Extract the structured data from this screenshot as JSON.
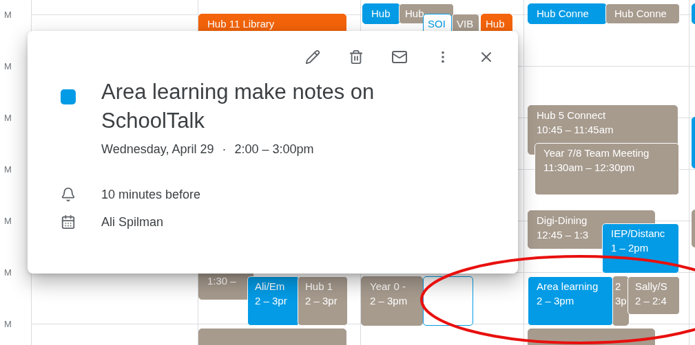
{
  "time_labels": [
    "M",
    "M",
    "M",
    "M",
    "M",
    "M",
    "M"
  ],
  "events": [
    {
      "kind": "filled",
      "color": "#f4640a",
      "title": "Hub 11 Library"
    },
    {
      "kind": "filled",
      "color": "#039be5",
      "title": "Hub"
    },
    {
      "kind": "filled",
      "color": "#a79b8e",
      "title": "Hub"
    },
    {
      "kind": "outlined",
      "color": "#039be5",
      "title": "SOI"
    },
    {
      "kind": "filled",
      "color": "#a79b8e",
      "title": "VIB"
    },
    {
      "kind": "filled",
      "color": "#f4640a",
      "title": "Hub"
    },
    {
      "kind": "filled",
      "color": "#039be5",
      "title": "Hub Conne"
    },
    {
      "kind": "filled",
      "color": "#a79b8e",
      "title": "Hub Conne"
    },
    {
      "kind": "filled",
      "color": "#039be5"
    },
    {
      "kind": "filled",
      "color": "#a79b8e",
      "title": "Hub 5 Connect",
      "time": "10:45 – 11:45am"
    },
    {
      "kind": "filled",
      "color": "#a79b8e",
      "title": "Year 7/8 Team Meeting",
      "time": "11:30am – 12:30pm"
    },
    {
      "kind": "filled",
      "color": "#039be5"
    },
    {
      "kind": "filled",
      "color": "#a79b8e",
      "title": "Digi-Dining",
      "time": "12:45 – 1:3"
    },
    {
      "kind": "filled",
      "color": "#a79b8e"
    },
    {
      "kind": "filled",
      "color": "#039be5",
      "title": "IEP/Distanc",
      "time": "1 – 2pm"
    },
    {
      "kind": "filled",
      "color": "#a79b8e",
      "time": "1:30 –"
    },
    {
      "kind": "filled",
      "color": "#039be5",
      "title": "Ali/Em",
      "time": "2 – 3pr"
    },
    {
      "kind": "filled",
      "color": "#a79b8e",
      "title": "Hub 1",
      "time": "2 – 3pr"
    },
    {
      "kind": "filled",
      "color": "#a79b8e",
      "title": "Year 0 -",
      "time": "2 – 3pm"
    },
    {
      "kind": "outlined",
      "color": "#039be5"
    },
    {
      "kind": "filled",
      "color": "#039be5",
      "title": "Area learning",
      "time": "2 – 3pm"
    },
    {
      "kind": "filled",
      "color": "#a79b8e",
      "title": "2",
      "time": "3p"
    },
    {
      "kind": "filled",
      "color": "#a79b8e",
      "title": "Sally/S",
      "time": "2 – 2:4"
    },
    {
      "kind": "filled",
      "color": "#a79b8e"
    },
    {
      "kind": "filled",
      "color": "#a79b8e"
    }
  ],
  "popup": {
    "color": "#039be5",
    "title": "Area learning make notes on SchoolTalk",
    "date": "Wednesday, April 29",
    "separator": "·",
    "time": "2:00 – 3:00pm",
    "reminder": "10 minutes before",
    "calendar": "Ali Spilman"
  }
}
